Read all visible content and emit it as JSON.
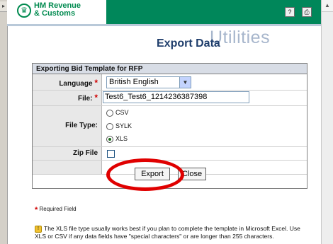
{
  "header": {
    "logo_line1": "HM Revenue",
    "logo_line2": "& Customs",
    "watermark": "Utilities",
    "page_title": "Export Data"
  },
  "form": {
    "heading": "Exporting Bid Template for RFP",
    "language_label": "Language",
    "language_value": "British English",
    "file_label": "File:",
    "file_value": "Test6_Test6_1214236387398",
    "filetype_label": "File Type:",
    "filetype_options": [
      "CSV",
      "SYLK",
      "XLS"
    ],
    "filetype_selected": "XLS",
    "zip_label": "Zip File",
    "zip_checked": false,
    "export_label": "Export",
    "close_label": "Close"
  },
  "notes": {
    "required_star": "*",
    "required_text": "Required Field",
    "info_text": "The XLS file type usually works best if you plan to complete the template in Microsoft Excel. Use XLS or CSV if any data fields have \"special characters\" or are longer than 255 characters."
  },
  "colors": {
    "brand_green": "#00875a",
    "title_blue": "#1e3d6b",
    "annotation_red": "#e00000"
  }
}
